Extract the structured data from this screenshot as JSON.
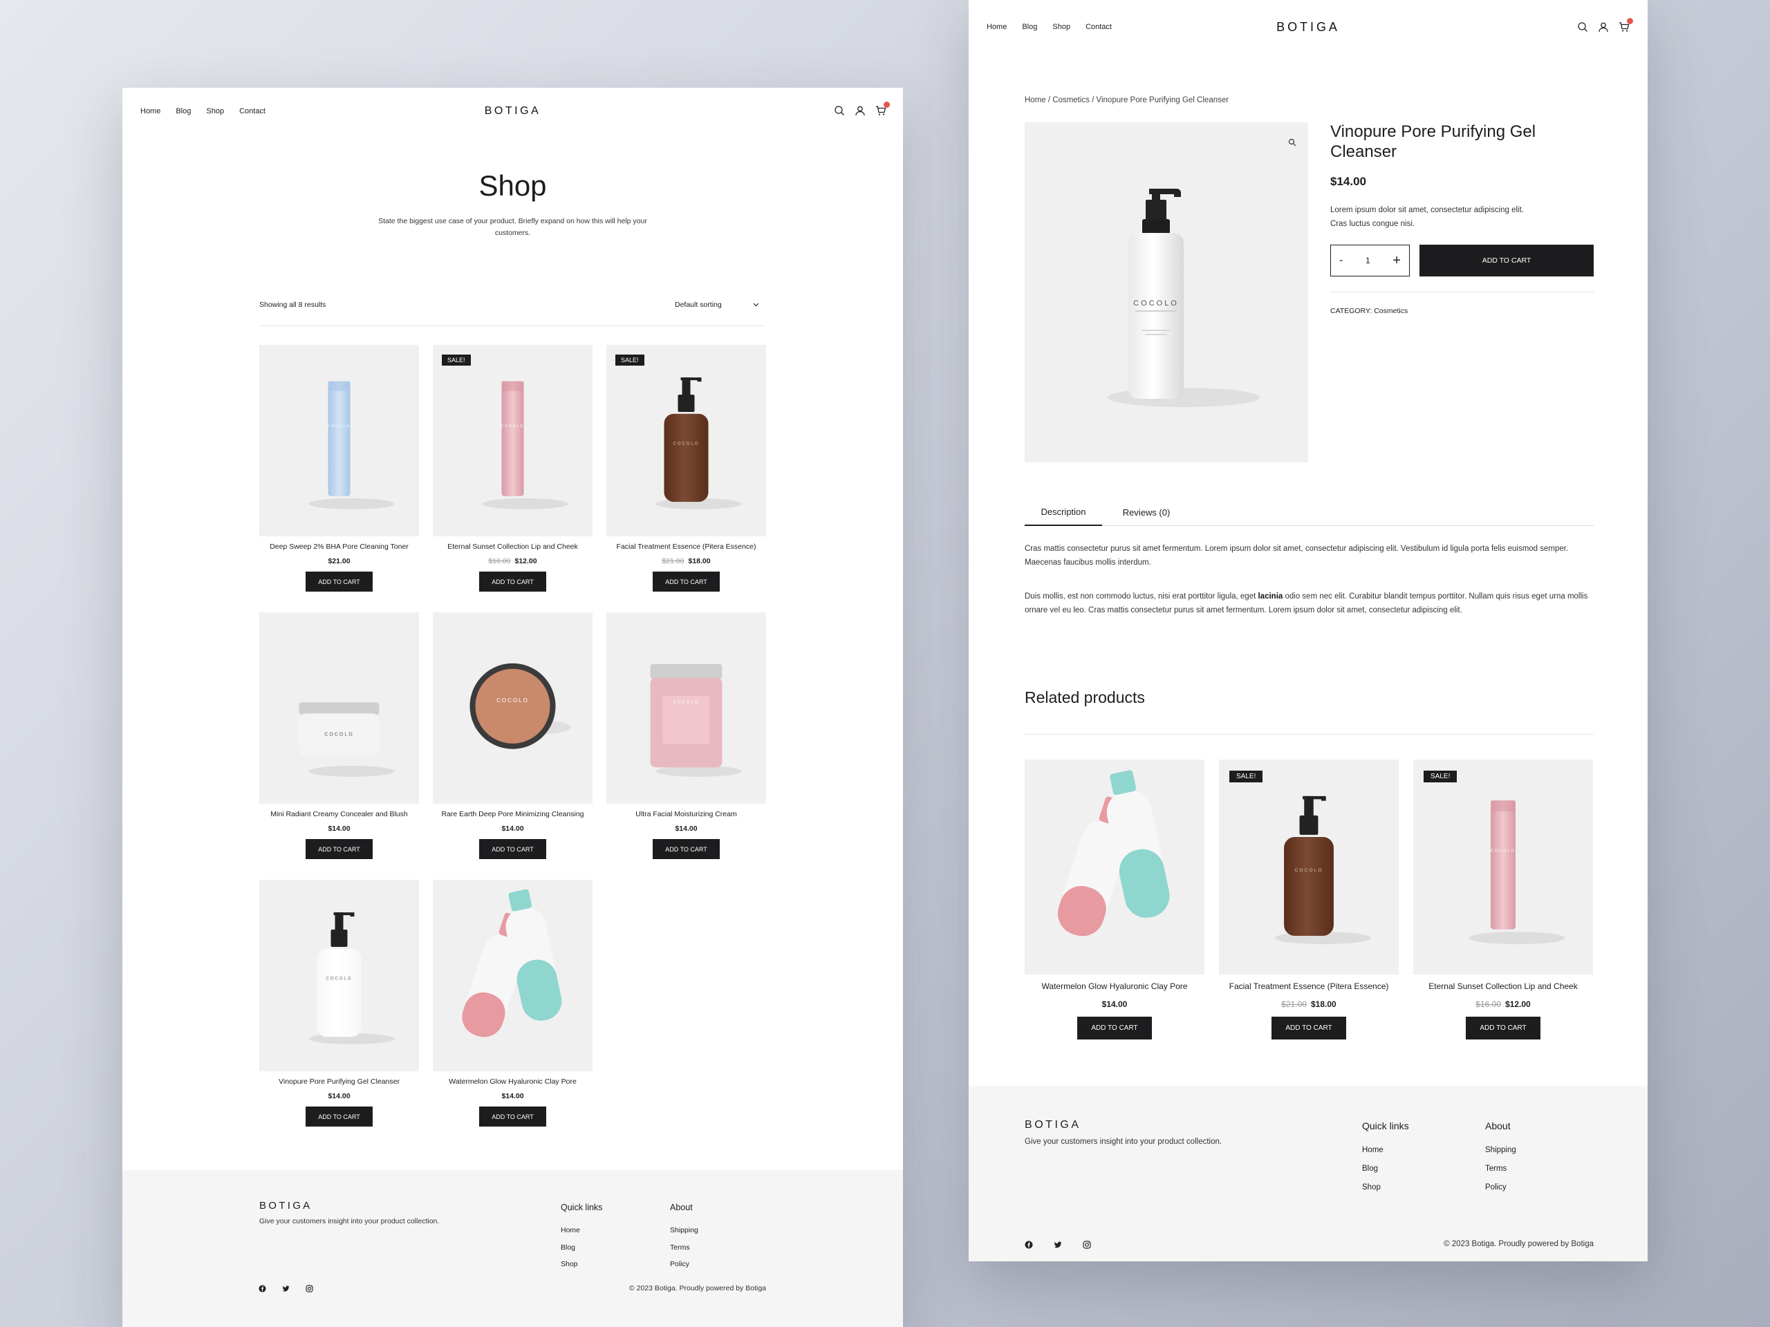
{
  "brand": "BOTIGA",
  "colors": {
    "accent": "#1d1d1f",
    "badge": "#e2574c",
    "card_bg": "#f0f0f0",
    "footer_bg": "#f5f5f5"
  },
  "nav": [
    {
      "label": "Home"
    },
    {
      "label": "Blog"
    },
    {
      "label": "Shop"
    },
    {
      "label": "Contact"
    }
  ],
  "icons": {
    "search": "search-icon",
    "account": "user-icon",
    "cart": "cart-icon"
  },
  "shop": {
    "title": "Shop",
    "subtitle": "State the biggest use case of your product. Briefly expand on how this will help your customers.",
    "results": "Showing all 8 results",
    "sorting": "Default sorting",
    "products": [
      {
        "name": "Deep Sweep 2% BHA Pore Cleaning Toner",
        "price": "$21.00",
        "old_price": "",
        "sale": "",
        "kind": "blue-bottle"
      },
      {
        "name": "Eternal Sunset Collection Lip and Cheek",
        "price": "$12.00",
        "old_price": "$16.00",
        "sale": "SALE!",
        "kind": "pink-bottle"
      },
      {
        "name": "Facial Treatment Essence (Pitera Essence)",
        "price": "$18.00",
        "old_price": "$21.00",
        "sale": "SALE!",
        "kind": "amber-pump"
      },
      {
        "name": "Mini Radiant Creamy Concealer and Blush",
        "price": "$14.00",
        "old_price": "",
        "sale": "",
        "kind": "white-jar"
      },
      {
        "name": "Rare Earth Deep Pore Minimizing Cleansing",
        "price": "$14.00",
        "old_price": "",
        "sale": "",
        "kind": "copper-tin"
      },
      {
        "name": "Ultra Facial Moisturizing Cream",
        "price": "$14.00",
        "old_price": "",
        "sale": "",
        "kind": "pink-jar"
      },
      {
        "name": "Vinopure Pore Purifying Gel Cleanser",
        "price": "$14.00",
        "old_price": "",
        "sale": "",
        "kind": "white-pump"
      },
      {
        "name": "Watermelon Glow Hyaluronic Clay Pore",
        "price": "$14.00",
        "old_price": "",
        "sale": "",
        "kind": "duo-bottles"
      }
    ],
    "add_to_cart": "ADD TO CART"
  },
  "product": {
    "breadcrumb": "Home / Cosmetics / Vinopure Pore Purifying Gel Cleanser",
    "title": "Vinopure Pore Purifying Gel Cleanser",
    "price": "$14.00",
    "short_desc": "Lorem ipsum dolor sit amet, consectetur adipiscing elit. Cras luctus congue nisi.",
    "qty_minus": "-",
    "qty": "1",
    "qty_plus": "+",
    "add_to_cart": "ADD TO CART",
    "category_label": "CATEGORY:",
    "category": "Cosmetics",
    "tabs": [
      {
        "label": "Description"
      },
      {
        "label": "Reviews (0)"
      }
    ],
    "desc_p1": "Cras mattis consectetur purus sit amet fermentum. Lorem ipsum dolor sit amet, consectetur adipiscing elit. Vestibulum id ligula porta felis euismod semper. Maecenas faucibus mollis interdum.",
    "desc_p2_a": "Duis mollis, est non commodo luctus, nisi erat porttitor ligula, eget ",
    "desc_p2_bold": "lacinia",
    "desc_p2_b": " odio sem nec elit. Curabitur blandit tempus porttitor. Nullam quis risus eget urna mollis ornare vel eu leo. Cras mattis consectetur purus sit amet fermentum. Lorem ipsum dolor sit amet, consectetur adipiscing elit.",
    "related_title": "Related products",
    "related": [
      {
        "name": "Watermelon Glow Hyaluronic Clay Pore",
        "price": "$14.00",
        "old_price": "",
        "sale": "",
        "kind": "duo-bottles"
      },
      {
        "name": "Facial Treatment Essence (Pitera Essence)",
        "price": "$18.00",
        "old_price": "$21.00",
        "sale": "SALE!",
        "kind": "amber-pump"
      },
      {
        "name": "Eternal Sunset Collection Lip and Cheek",
        "price": "$12.00",
        "old_price": "$16.00",
        "sale": "SALE!",
        "kind": "pink-bottle"
      }
    ]
  },
  "footer": {
    "logo": "BOTIGA",
    "tagline": "Give your customers insight into your product collection.",
    "quick_title": "Quick links",
    "quick": [
      {
        "label": "Home"
      },
      {
        "label": "Blog"
      },
      {
        "label": "Shop"
      }
    ],
    "about_title": "About",
    "about": [
      {
        "label": "Shipping"
      },
      {
        "label": "Terms"
      },
      {
        "label": "Policy"
      }
    ],
    "social": [
      "facebook-icon",
      "twitter-icon",
      "instagram-icon"
    ],
    "copyright": "© 2023 Botiga. Proudly powered by Botiga"
  }
}
